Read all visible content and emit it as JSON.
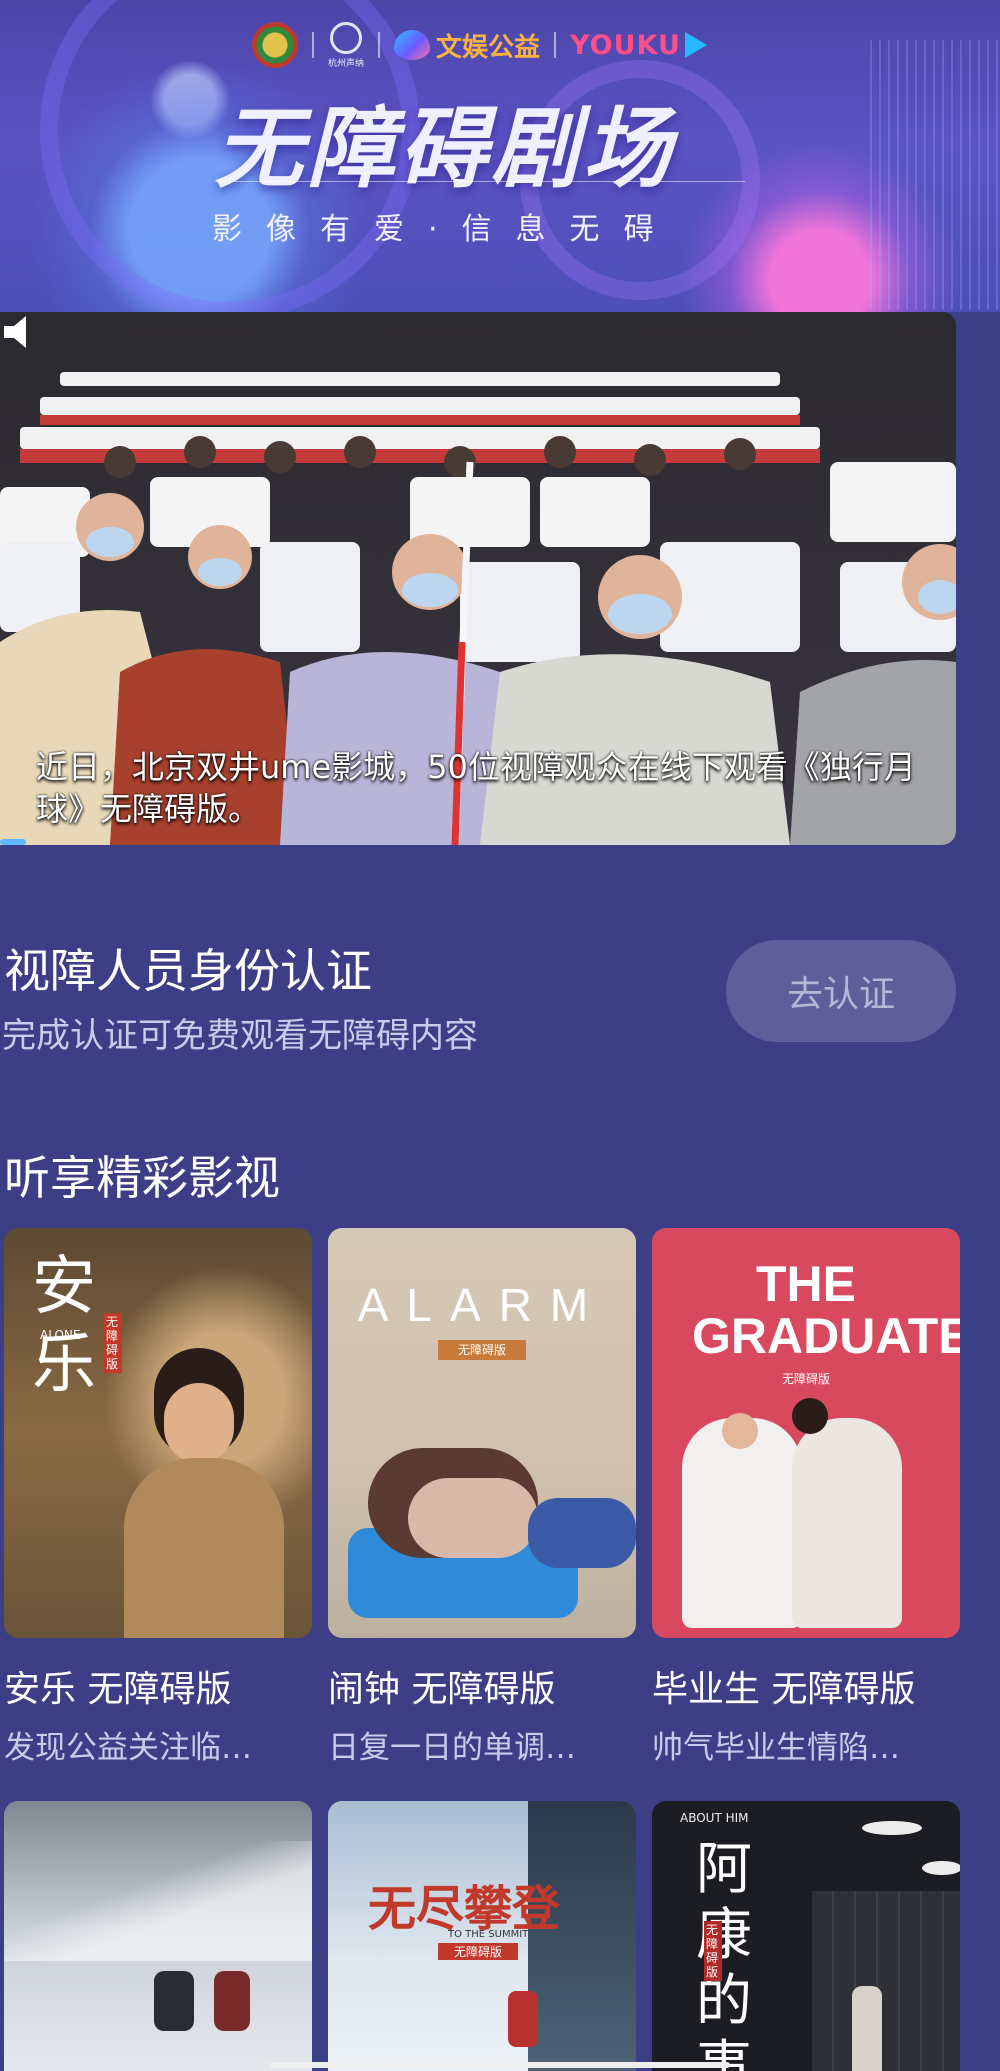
{
  "banner": {
    "logo_voice_text": "杭州声纳",
    "logo_wenmei": "文娱公益",
    "logo_youku": "YOUKU",
    "title": "无障碍剧场",
    "subtitle": "影像有爱·信息无碍"
  },
  "video": {
    "caption": "近日，北京双井ume影城，50位视障观众在线下观看《独行月球》无障碍版。"
  },
  "verify": {
    "title": "视障人员身份认证",
    "subtitle": "完成认证可免费观看无障碍内容",
    "button": "去认证"
  },
  "section": {
    "title": "听享精彩影视"
  },
  "movies": [
    {
      "title": "安乐 无障碍版",
      "desc": "发现公益关注临…",
      "poster_text": "安乐",
      "poster_en": "ALONE",
      "badge": "无障碍版"
    },
    {
      "title": "闹钟 无障碍版",
      "desc": "日复一日的单调…",
      "poster_text": "ALARM",
      "badge": "无障碍版"
    },
    {
      "title": "毕业生 无障碍版",
      "desc": "帅气毕业生情陷…",
      "poster_text": "THE GRADUATE",
      "badge": "无障碍版"
    }
  ],
  "movies_row2": [
    {
      "poster_text": ""
    },
    {
      "poster_text": "无尽攀登",
      "poster_en": "TO THE SUMMIT",
      "badge": "无障碍版"
    },
    {
      "poster_text": "阿康的事",
      "poster_en": "ABOUT HIM",
      "badge": "无障碍版"
    }
  ]
}
